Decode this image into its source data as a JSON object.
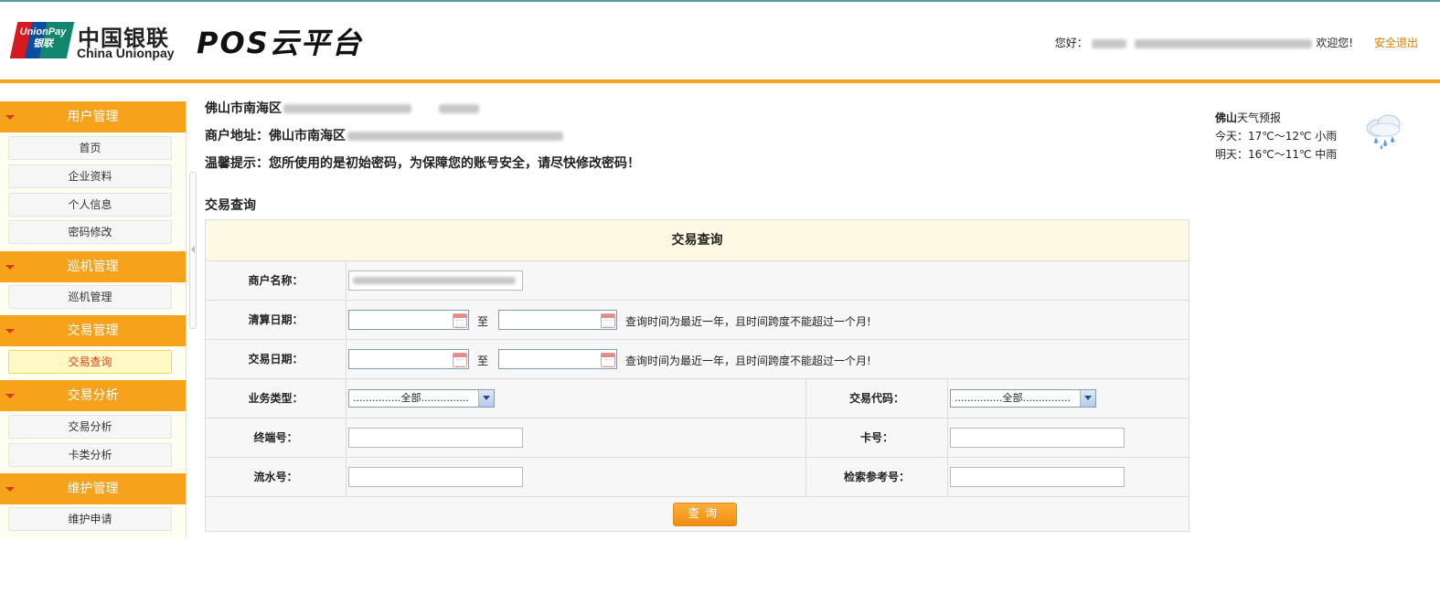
{
  "header": {
    "logo_text_cn": "中国银联",
    "logo_text_en": "China Unionpay",
    "logo_badge_line1": "UnionPay",
    "logo_badge_line2": "银联",
    "brand_title": "POS云平台",
    "greeting_prefix": "您好：",
    "greeting_suffix": "欢迎您!",
    "logout_label": "安全退出"
  },
  "sidebar": {
    "groups": [
      {
        "title": "用户管理",
        "items": [
          "首页",
          "企业资料",
          "个人信息",
          "密码修改"
        ]
      },
      {
        "title": "巡机管理",
        "items": [
          "巡机管理"
        ]
      },
      {
        "title": "交易管理",
        "items": [
          "交易查询"
        ]
      },
      {
        "title": "交易分析",
        "items": [
          "交易分析",
          "卡类分析"
        ]
      },
      {
        "title": "维护管理",
        "items": [
          "维护申请"
        ]
      }
    ],
    "active_item": "交易查询"
  },
  "info": {
    "merchant_line_prefix": "佛山市南海区",
    "address_label": "商户地址：佛山市南海区",
    "warning": "温馨提示：您所使用的是初始密码，为保障您的账号安全，请尽快修改密码！"
  },
  "section_title": "交易查询",
  "weather": {
    "city": "佛山",
    "title_suffix": "天气预报",
    "today": "今天：17℃～12℃ 小雨",
    "tomorrow": "明天：16℃～11℃ 中雨"
  },
  "form": {
    "title": "交易查询",
    "merchant_name_label": "商户名称：",
    "settle_date_label": "清算日期：",
    "trade_date_label": "交易日期：",
    "range_sep": "至",
    "date_hint": "查询时间为最近一年，且时间跨度不能超过一个月!",
    "biz_type_label": "业务类型：",
    "biz_type_value": "...............全部...............",
    "trade_code_label": "交易代码：",
    "trade_code_value": "...............全部...............",
    "terminal_label": "终端号：",
    "card_label": "卡号：",
    "serial_label": "流水号：",
    "ref_label": "检索参考号：",
    "query_button": "查询"
  }
}
